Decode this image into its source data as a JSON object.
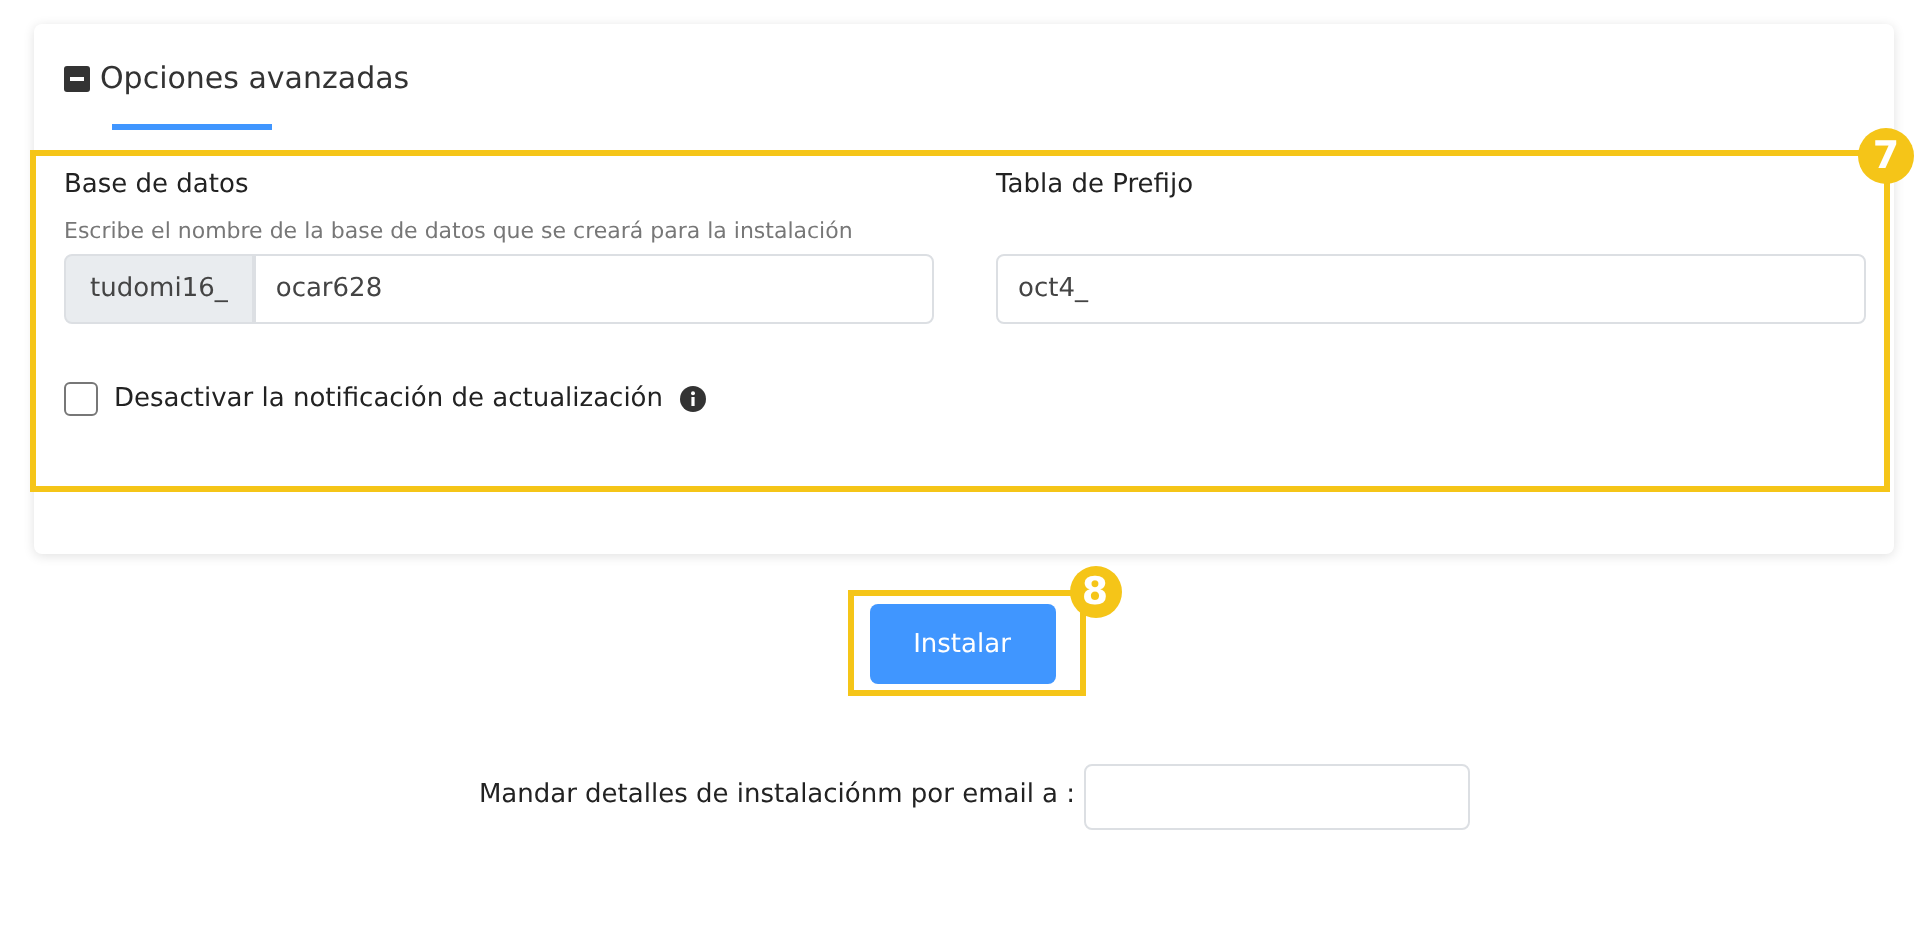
{
  "advanced_options": {
    "title": "Opciones avanzadas",
    "expanded": true,
    "callout": "7",
    "database": {
      "label": "Base de datos",
      "hint": "Escribe el nombre de la base de datos que se creará para la instalación",
      "prefix": "tudomi16_",
      "value": "ocar628"
    },
    "table_prefix": {
      "label": "Tabla de Prefijo",
      "value": "oct4_"
    },
    "disable_update_notification": {
      "label": "Desactivar la notificación de actualización",
      "checked": false
    }
  },
  "install_button": {
    "label": "Instalar",
    "callout": "8"
  },
  "email": {
    "label": "Mandar detalles de instalaciónm por email a :"
  }
}
